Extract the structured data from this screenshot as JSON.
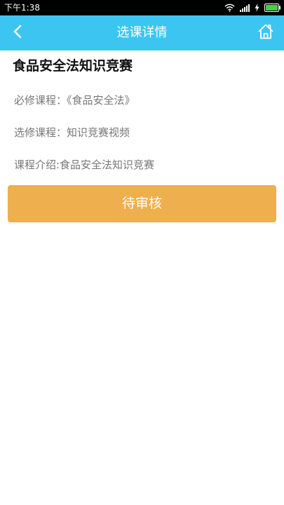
{
  "status_bar": {
    "time": "下午1:38",
    "icons": [
      "wifi-icon",
      "signal-icon",
      "charging-icon",
      "battery-icon"
    ]
  },
  "header": {
    "title": "选课详情",
    "back_icon": "chevron-left-icon",
    "home_icon": "home-icon",
    "background": "#3dc5f2"
  },
  "course": {
    "name": "食品安全法知识竞赛",
    "required": "必修课程：《食品安全法》",
    "elective": "选修课程：知识竞赛视频",
    "intro": "课程介绍:食品安全法知识竞赛"
  },
  "action": {
    "label": "待审核",
    "color": "#eeaf4f"
  }
}
